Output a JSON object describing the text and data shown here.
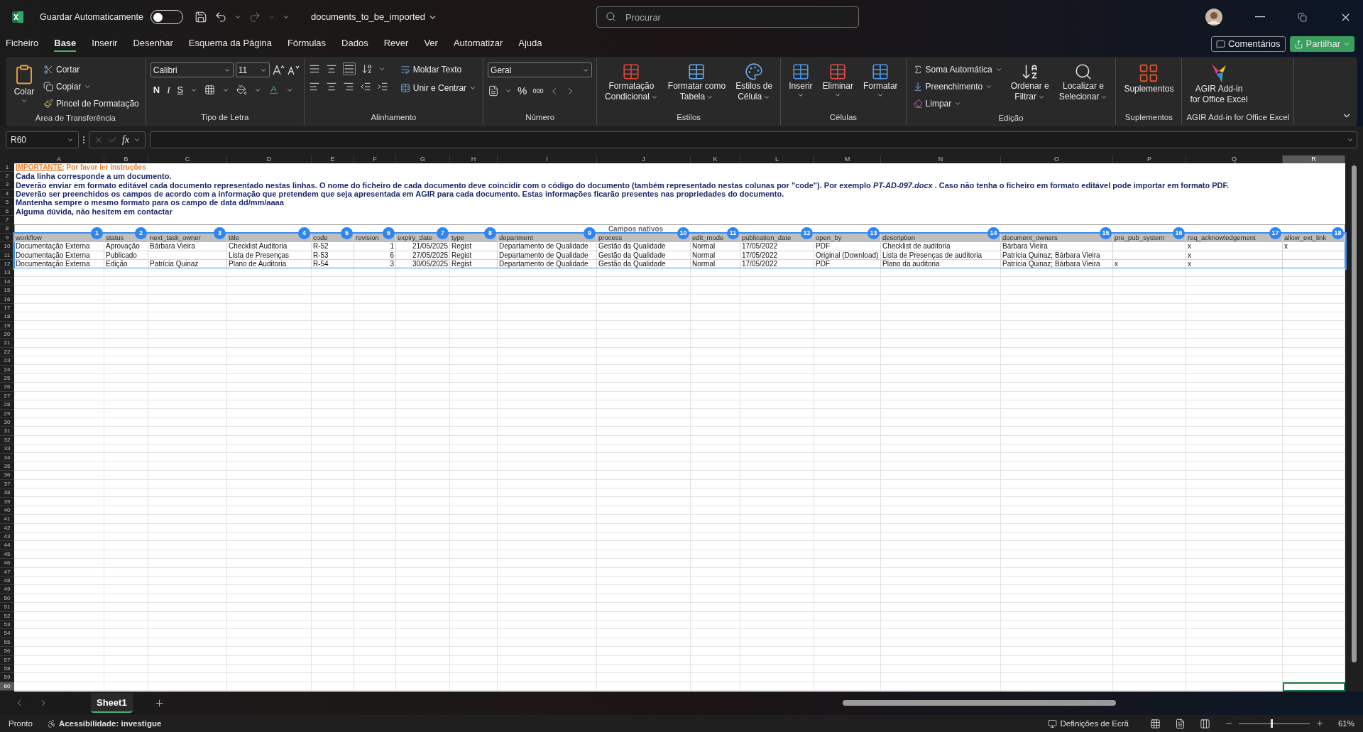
{
  "title_bar": {
    "autosave_label": "Guardar Automaticamente",
    "autosave_on": false,
    "filename": "documents_to_be_imported",
    "search_placeholder": "Procurar"
  },
  "menu_tabs": [
    {
      "label": "Ficheiro",
      "selected": false
    },
    {
      "label": "Base",
      "selected": true
    },
    {
      "label": "Inserir",
      "selected": false
    },
    {
      "label": "Desenhar",
      "selected": false
    },
    {
      "label": "Esquema da Página",
      "selected": false
    },
    {
      "label": "Fórmulas",
      "selected": false
    },
    {
      "label": "Dados",
      "selected": false
    },
    {
      "label": "Rever",
      "selected": false
    },
    {
      "label": "Ver",
      "selected": false
    },
    {
      "label": "Automatizar",
      "selected": false
    },
    {
      "label": "Ajuda",
      "selected": false
    }
  ],
  "actions": {
    "comments": "Comentários",
    "share": "Partilhar"
  },
  "ribbon_groups": [
    {
      "label": "Área de Transferência",
      "items": [
        {
          "label": "Colar"
        },
        {
          "label": "Cortar"
        },
        {
          "label": "Copiar"
        },
        {
          "label": "Pincel de Formatação"
        }
      ]
    },
    {
      "label": "Tipo de Letra",
      "items": [
        {
          "label": "Calibri"
        },
        {
          "label": "11"
        },
        {
          "label": "N"
        },
        {
          "label": "I"
        },
        {
          "label": "S"
        }
      ]
    },
    {
      "label": "Alinhamento",
      "items": [
        {
          "label": "Moldar Texto"
        },
        {
          "label": "Unir e Centrar"
        }
      ]
    },
    {
      "label": "Número",
      "items": [
        {
          "label": "Geral"
        },
        {
          "label": "%"
        },
        {
          "label": "000"
        }
      ]
    },
    {
      "label": "Estilos",
      "items": [
        {
          "lines": [
            "Formatação",
            "Condicional"
          ]
        },
        {
          "lines": [
            "Formatar como",
            "Tabela"
          ]
        },
        {
          "lines": [
            "Estilos de",
            "Célula"
          ]
        }
      ]
    },
    {
      "label": "Células",
      "items": [
        {
          "lines": [
            "Inserir"
          ]
        },
        {
          "lines": [
            "Eliminar"
          ]
        },
        {
          "lines": [
            "Formatar"
          ]
        }
      ]
    },
    {
      "label": "Edição",
      "items": [
        {
          "label": "Soma Automática"
        },
        {
          "label": "Preenchimento"
        },
        {
          "label": "Limpar"
        },
        {
          "lines": [
            "Ordenar e",
            "Filtrar"
          ]
        },
        {
          "lines": [
            "Localizar e",
            "Selecionar"
          ]
        }
      ]
    },
    {
      "label": "Suplementos",
      "items": [
        {
          "lines": [
            "Suplementos"
          ]
        }
      ]
    },
    {
      "label": "AGIR Add-in for Office Excel",
      "items": [
        {
          "lines": [
            "AGIR Add-in",
            "for Office Excel"
          ]
        }
      ]
    }
  ],
  "formula_bar": {
    "name_box": "R60",
    "fx": "fx"
  },
  "sheet": {
    "columns": [
      {
        "letter": "A",
        "header": "workflow",
        "badge": "1",
        "selected": false
      },
      {
        "letter": "B",
        "header": "status",
        "badge": "2",
        "selected": false
      },
      {
        "letter": "C",
        "header": "next_task_owner",
        "badge": "3",
        "selected": false
      },
      {
        "letter": "D",
        "header": "title",
        "badge": "4",
        "selected": false
      },
      {
        "letter": "E",
        "header": "code",
        "badge": "5",
        "selected": false
      },
      {
        "letter": "F",
        "header": "revision",
        "badge": "6",
        "selected": false
      },
      {
        "letter": "G",
        "header": "expiry_date",
        "badge": "7",
        "selected": false
      },
      {
        "letter": "H",
        "header": "type",
        "badge": "8",
        "selected": false
      },
      {
        "letter": "I",
        "header": "department",
        "badge": "9",
        "selected": false
      },
      {
        "letter": "J",
        "header": "process",
        "badge": "10",
        "selected": false
      },
      {
        "letter": "K",
        "header": "edit_mode",
        "badge": "11",
        "selected": false
      },
      {
        "letter": "L",
        "header": "publication_date",
        "badge": "12",
        "selected": false
      },
      {
        "letter": "M",
        "header": "open_by",
        "badge": "13",
        "selected": false
      },
      {
        "letter": "N",
        "header": "description",
        "badge": "14",
        "selected": false
      },
      {
        "letter": "O",
        "header": "document_owners",
        "badge": "15",
        "selected": false
      },
      {
        "letter": "P",
        "header": "pre_pub_system",
        "badge": "16",
        "selected": false
      },
      {
        "letter": "Q",
        "header": "req_acknowledgement",
        "badge": "17",
        "selected": false
      },
      {
        "letter": "R",
        "header": "allow_ext_link",
        "badge": "18",
        "selected": true
      }
    ],
    "important": {
      "label": "IMPORTANTE:",
      "text": "Por favor ler instruções"
    },
    "instructions": [
      "Cada linha corresponde a um documento.",
      "Deverão enviar em formato editável cada documento representado nestas linhas. O nome do ficheiro de cada documento deve coincidir com o código do documento (também representado nestas colunas por \"code\"). Por exemplo *PT-AD-097.docx* . Caso não tenha o ficheiro em formato editável pode importar em formato PDF.",
      "Deverão ser preenchidos os campos de acordo com a informação que pretendem que seja apresentada em AGIR para cada documento. Estas informações ficarão presentes nas propriedades do documento.",
      "Mantenha sempre o mesmo formato para os campo de data dd/mm/aaaa",
      "Alguma dúvida, não hesitem em contactar"
    ],
    "group_title": "Campos nativos",
    "rows": [
      [
        "Documentação Externa",
        "Aprovação",
        "Bárbara Vieira",
        "Checklist Auditoria",
        "R-52",
        "1",
        "21/05/2025",
        "Regist",
        "Departamento de Qualidade",
        "Gestão da Qualidade",
        "Normal",
        "17/05/2022",
        "PDF",
        "Checklist de auditoria",
        "Bárbara Vieira",
        null,
        "x",
        "x"
      ],
      [
        "Documentação Externa",
        "Publicado",
        null,
        "Lista de Presenças",
        "R-53",
        "6",
        "27/05/2025",
        "Regist",
        "Departamento de Qualidade",
        "Gestão da Qualidade",
        "Normal",
        "17/05/2022",
        "Original (Download)",
        "Lista de Presenças de auditoria",
        "Patrícia Quinaz; Bárbara Vieira",
        null,
        "x",
        null
      ],
      [
        "Documentação Externa",
        "Edição",
        "Patrícia Quinaz",
        "Plano de Auditoria",
        "R-54",
        "3",
        "30/05/2025",
        "Regist",
        "Departamento de Qualidade",
        "Gestão da Qualidade",
        "Normal",
        "17/05/2022",
        "PDF",
        "Plano da auditoria",
        "Patrícia Quinaz; Bárbara Vieira",
        "x",
        "x",
        null
      ]
    ],
    "row_headers": [
      {
        "label": "1",
        "selected": false
      },
      {
        "label": "2",
        "selected": false
      },
      {
        "label": "3",
        "selected": false
      },
      {
        "label": "4",
        "selected": false
      },
      {
        "label": "5",
        "selected": false
      },
      {
        "label": "6",
        "selected": false
      },
      {
        "label": "7",
        "selected": false
      },
      {
        "label": "8",
        "selected": false
      },
      {
        "label": "9",
        "selected": false
      },
      {
        "label": "10",
        "selected": false
      },
      {
        "label": "11",
        "selected": false
      },
      {
        "label": "12",
        "selected": false
      },
      {
        "label": "13",
        "selected": false
      },
      {
        "label": "14",
        "selected": false
      },
      {
        "label": "15",
        "selected": false
      },
      {
        "label": "16",
        "selected": false
      },
      {
        "label": "17",
        "selected": false
      },
      {
        "label": "18",
        "selected": false
      },
      {
        "label": "19",
        "selected": false
      },
      {
        "label": "20",
        "selected": false
      },
      {
        "label": "21",
        "selected": false
      },
      {
        "label": "22",
        "selected": false
      },
      {
        "label": "23",
        "selected": false
      },
      {
        "label": "24",
        "selected": false
      },
      {
        "label": "25",
        "selected": false
      },
      {
        "label": "26",
        "selected": false
      },
      {
        "label": "27",
        "selected": false
      },
      {
        "label": "28",
        "selected": false
      },
      {
        "label": "29",
        "selected": false
      },
      {
        "label": "30",
        "selected": false
      },
      {
        "label": "31",
        "selected": false
      },
      {
        "label": "32",
        "selected": false
      },
      {
        "label": "33",
        "selected": false
      },
      {
        "label": "34",
        "selected": false
      },
      {
        "label": "35",
        "selected": false
      },
      {
        "label": "36",
        "selected": false
      },
      {
        "label": "37",
        "selected": false
      },
      {
        "label": "38",
        "selected": false
      },
      {
        "label": "39",
        "selected": false
      },
      {
        "label": "40",
        "selected": false
      },
      {
        "label": "41",
        "selected": false
      },
      {
        "label": "42",
        "selected": false
      },
      {
        "label": "43",
        "selected": false
      },
      {
        "label": "44",
        "selected": false
      },
      {
        "label": "45",
        "selected": false
      },
      {
        "label": "46",
        "selected": false
      },
      {
        "label": "47",
        "selected": false
      },
      {
        "label": "48",
        "selected": false
      },
      {
        "label": "49",
        "selected": false
      },
      {
        "label": "50",
        "selected": false
      },
      {
        "label": "51",
        "selected": false
      },
      {
        "label": "52",
        "selected": false
      },
      {
        "label": "53",
        "selected": false
      },
      {
        "label": "54",
        "selected": false
      },
      {
        "label": "55",
        "selected": false
      },
      {
        "label": "56",
        "selected": false
      },
      {
        "label": "57",
        "selected": false
      },
      {
        "label": "58",
        "selected": false
      },
      {
        "label": "59",
        "selected": false
      },
      {
        "label": "60",
        "selected": true
      }
    ]
  },
  "sheet_tabs": [
    {
      "label": "Sheet1",
      "selected": true
    }
  ],
  "status_bar": {
    "ready": "Pronto",
    "accessibility": "Acessibilidade: investigue",
    "display_settings": "Definições de Ecrã",
    "zoom": "61%",
    "zoom_slider": {
      "level": 0.45
    }
  }
}
